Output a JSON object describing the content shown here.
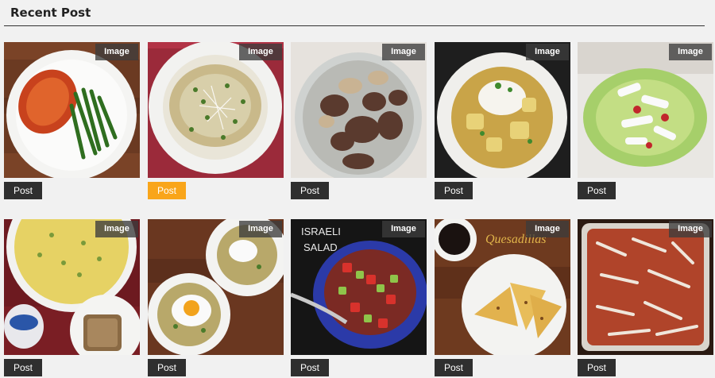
{
  "section": {
    "title": "Recent Post"
  },
  "posts": [
    {
      "image_label": "Image",
      "post_label": "Post",
      "active": false
    },
    {
      "image_label": "Image",
      "post_label": "Post",
      "active": true
    },
    {
      "image_label": "Image",
      "post_label": "Post",
      "active": false
    },
    {
      "image_label": "Image",
      "post_label": "Post",
      "active": false
    },
    {
      "image_label": "Image",
      "post_label": "Post",
      "active": false
    },
    {
      "image_label": "Image",
      "post_label": "Post",
      "active": false
    },
    {
      "image_label": "Image",
      "post_label": "Post",
      "active": false
    },
    {
      "image_label": "Image",
      "post_label": "Post",
      "active": false,
      "photo_text": [
        "ISRAELI",
        "SALAD"
      ]
    },
    {
      "image_label": "Image",
      "post_label": "Post",
      "active": false,
      "photo_text": [
        "Quesadillas"
      ]
    },
    {
      "image_label": "Image",
      "post_label": "Post",
      "active": false
    }
  ],
  "colors": {
    "accent": "#f9a51a",
    "button": "#2f2f2f",
    "label_bg": "#3c3c3c"
  }
}
